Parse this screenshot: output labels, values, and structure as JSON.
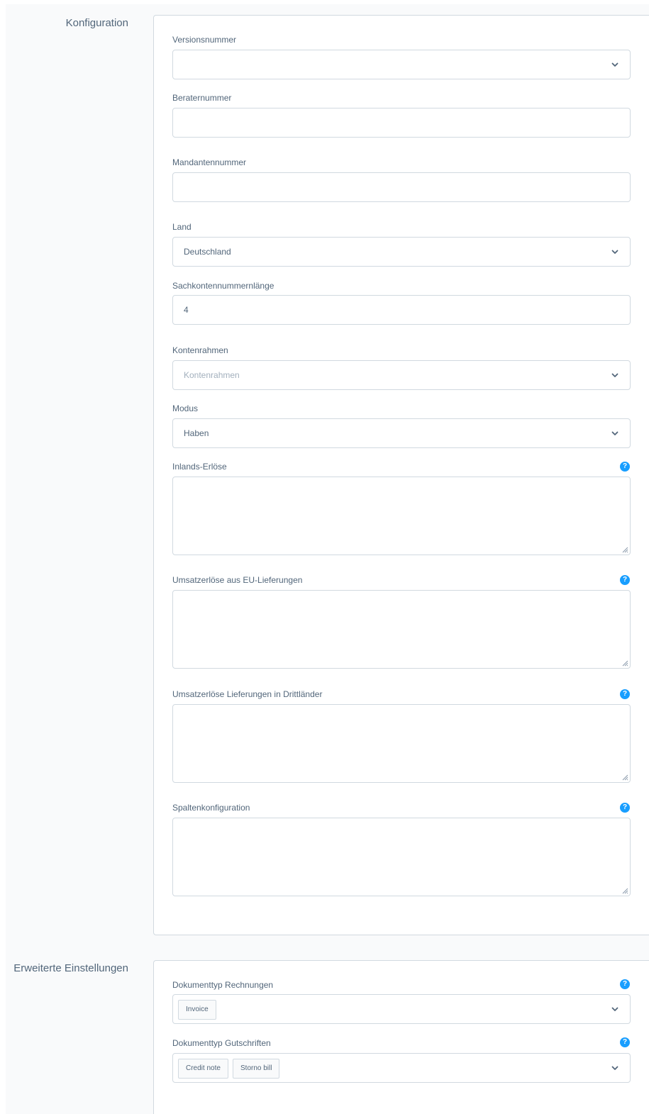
{
  "sections": {
    "configuration_title": "Konfiguration",
    "advanced_title": "Erweiterte Einstellungen"
  },
  "fields": {
    "version": {
      "label": "Versionsnummer",
      "value": ""
    },
    "consultant": {
      "label": "Beraternummer",
      "value": ""
    },
    "client": {
      "label": "Mandantennummer",
      "value": ""
    },
    "country": {
      "label": "Land",
      "value": "Deutschland"
    },
    "account_length": {
      "label": "Sachkontennummernlänge",
      "value": "4"
    },
    "chart_of_accounts": {
      "label": "Kontenrahmen",
      "placeholder": "Kontenrahmen"
    },
    "mode": {
      "label": "Modus",
      "value": "Haben"
    },
    "domestic_revenue": {
      "label": "Inlands-Erlöse",
      "value": ""
    },
    "eu_revenue": {
      "label": "Umsatzerlöse aus EU-Lieferungen",
      "value": ""
    },
    "third_country_revenue": {
      "label": "Umsatzerlöse Lieferungen in Drittländer",
      "value": ""
    },
    "column_config": {
      "label": "Spaltenkonfiguration",
      "value": ""
    },
    "invoice_doc_type": {
      "label": "Dokumenttyp Rechnungen",
      "tags": [
        "Invoice"
      ]
    },
    "credit_doc_type": {
      "label": "Dokumenttyp Gutschriften",
      "tags": [
        "Credit note",
        "Storno bill"
      ]
    }
  },
  "help_icon_glyph": "?",
  "icons": {
    "select": "chevron-down-icon",
    "help": "help-icon",
    "resize": "resize-handle-icon"
  },
  "colors": {
    "accent": "#189eff",
    "border": "#d1d9e0",
    "text": "#52667a",
    "placeholder": "#a3b0bd",
    "background": "#f9fafb"
  }
}
